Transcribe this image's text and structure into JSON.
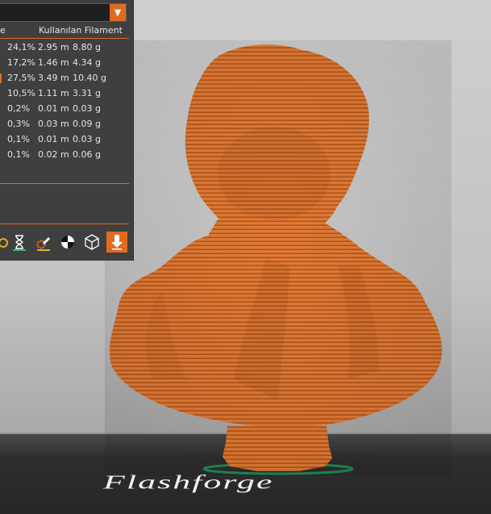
{
  "viewer": {
    "model_color": "#e07a35",
    "background_color": "#c4c4c4",
    "bed_color": "#2c2c2c"
  },
  "panel": {
    "selector": {
      "arrow_icon": "triangle-down-icon"
    },
    "headers": {
      "col_fragment": "e",
      "filament": "Kullanılan Filament"
    },
    "rows": [
      {
        "percent": "24,1%",
        "length": "2.95 m",
        "weight": "8.80 g",
        "active": false
      },
      {
        "percent": "17,2%",
        "length": "1.46 m",
        "weight": "4.34 g",
        "active": false
      },
      {
        "percent": "27,5%",
        "length": "3.49 m",
        "weight": "10.40 g",
        "active": true
      },
      {
        "percent": "10,5%",
        "length": "1.11 m",
        "weight": "3.31 g",
        "active": false
      },
      {
        "percent": "0,2%",
        "length": "0.01 m",
        "weight": "0.03 g",
        "active": false
      },
      {
        "percent": "0,3%",
        "length": "0.03 m",
        "weight": "0.09 g",
        "active": false
      },
      {
        "percent": "0,1%",
        "length": "0.01 m",
        "weight": "0.03 g",
        "active": false
      },
      {
        "percent": "0,1%",
        "length": "0.02 m",
        "weight": "0.06 g",
        "active": false
      }
    ],
    "tools": [
      {
        "name": "temperature-icon",
        "underline": "#e0b020"
      },
      {
        "name": "hourglass-icon",
        "underline": "#3bb36a"
      },
      {
        "name": "pencil-gear-icon",
        "underline": "#e0b020"
      },
      {
        "name": "half-circle-icon",
        "underline": ""
      },
      {
        "name": "cube-outline-icon",
        "underline": ""
      },
      {
        "name": "download-arrow-icon",
        "underline": "",
        "active": true
      }
    ]
  },
  "bed_logo": {
    "text": "Flashforge"
  }
}
